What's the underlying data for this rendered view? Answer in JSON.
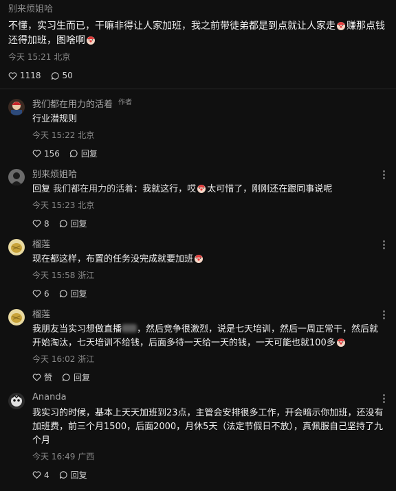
{
  "top": {
    "author": "别来烦姐哈",
    "text_1": "不懂，实习生而已，干嘛非得让人家加班，我之前带徒弟都是到点就让人家走",
    "text_2": "赚那点钱",
    "text_3": "还得加班，图啥啊",
    "time": "今天 15:21 北京",
    "likes": "1118",
    "comments": "50"
  },
  "comments": [
    {
      "name": "我们都在用力的活着",
      "badge": "作者",
      "text": "行业潜规则",
      "time": "今天 15:22 北京",
      "likes": "156",
      "reply": "回复"
    },
    {
      "name": "别来烦姐哈",
      "reply_prefix": "回复",
      "reply_target": "我们都在用力的活着",
      "text_a": "：我就这行，哎",
      "text_b": "太可惜了，刚刚还在跟同事说呢",
      "time": "今天 15:23 北京",
      "likes": "8",
      "reply": "回复"
    },
    {
      "name": "榴莲",
      "text": "现在都这样，布置的任务没完成就要加班",
      "time": "今天 15:58 浙江",
      "likes": "6",
      "reply": "回复"
    },
    {
      "name": "榴莲",
      "text_a": "我朋友当实习想做直播",
      "text_b": "，然后竞争很激烈，说是七天培训，然后一周正常干，然后就开始淘汰，七天培训不给钱，后面多待一天给一天的钱，一天可能也就100多",
      "time": "今天 16:02 浙江",
      "likes": "赞",
      "reply": "回复"
    },
    {
      "name": "Ananda",
      "text": "我实习的时候，基本上天天加班到23点，主管会安排很多工作，开会暗示你加班，还没有加班费，前三个月1500，后面2000，月休5天（法定节假日不放），真佩服自己坚持了九个月",
      "time": "今天 16:49 广西",
      "likes": "4",
      "reply": "回复"
    }
  ],
  "icons": {
    "heart": "heart-icon",
    "comment": "comment-icon",
    "more": "more-icon",
    "emoji": "clown-emoji-icon"
  }
}
